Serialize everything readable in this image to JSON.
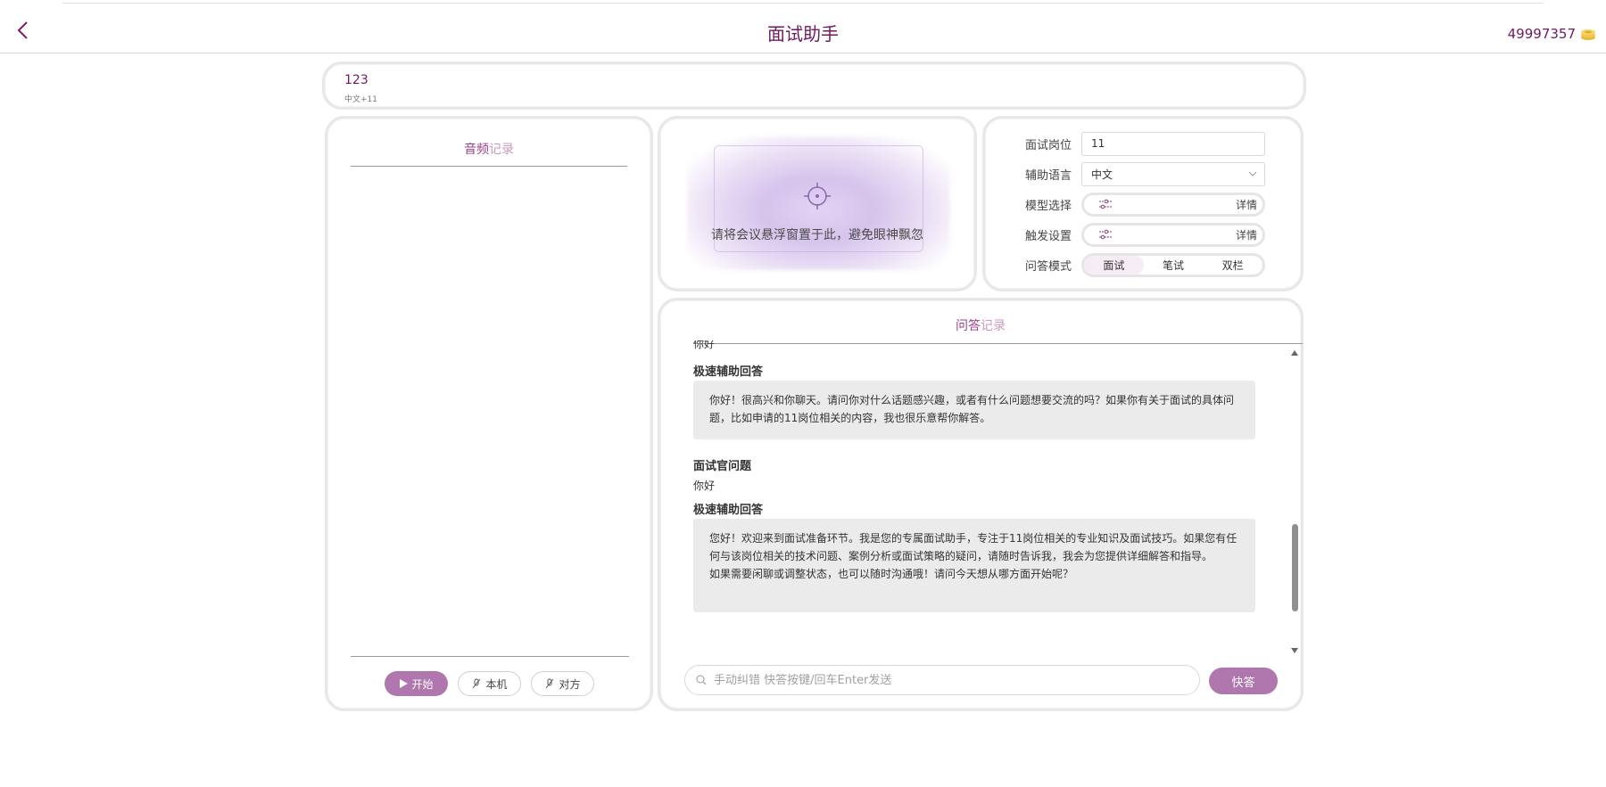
{
  "header": {
    "title": "面试助手",
    "coins": "49997357"
  },
  "session": {
    "name": "123",
    "sub": "中文+11"
  },
  "audio": {
    "title_a": "音频",
    "title_b": "记录",
    "start_label": "开始",
    "self_label": "本机",
    "other_label": "对方"
  },
  "video": {
    "hint": "请将会议悬浮窗置于此，避免眼神飘忽"
  },
  "settings": {
    "position_label": "面试岗位",
    "position_value": "11",
    "language_label": "辅助语言",
    "language_value": "中文",
    "model_label": "模型选择",
    "model_detail": "详情",
    "trigger_label": "触发设置",
    "trigger_detail": "详情",
    "mode_label": "问答模式",
    "modes": [
      "面试",
      "笔试",
      "双栏"
    ],
    "selected_mode": "面试"
  },
  "qa": {
    "title_a": "问答",
    "title_b": "记录",
    "partial_question": "你好",
    "items": [
      {
        "answer_label": "极速辅助回答",
        "answer": "你好！很高兴和你聊天。请问你对什么话题感兴趣，或者有什么问题想要交流的吗？如果你有关于面试的具体问题，比如申请的11岗位相关的内容，我也很乐意帮你解答。"
      },
      {
        "question_label": "面试官问题",
        "question": "你好",
        "answer_label": "极速辅助回答",
        "answer_p1": "您好！欢迎来到面试准备环节。我是您的专属面试助手，专注于11岗位相关的专业知识及面试技巧。如果您有任何与该岗位相关的技术问题、案例分析或面试策略的疑问，请随时告诉我，我会为您提供详细解答和指导。",
        "answer_p2": "如果需要闲聊或调整状态，也可以随时沟通哦！请问今天想从哪方面开始呢？"
      }
    ],
    "input_placeholder": "手动纠错 快答按键/回车Enter发送",
    "send_label": "快答"
  },
  "colors": {
    "accent": "#b076ae",
    "title": "#6e1a5e"
  }
}
